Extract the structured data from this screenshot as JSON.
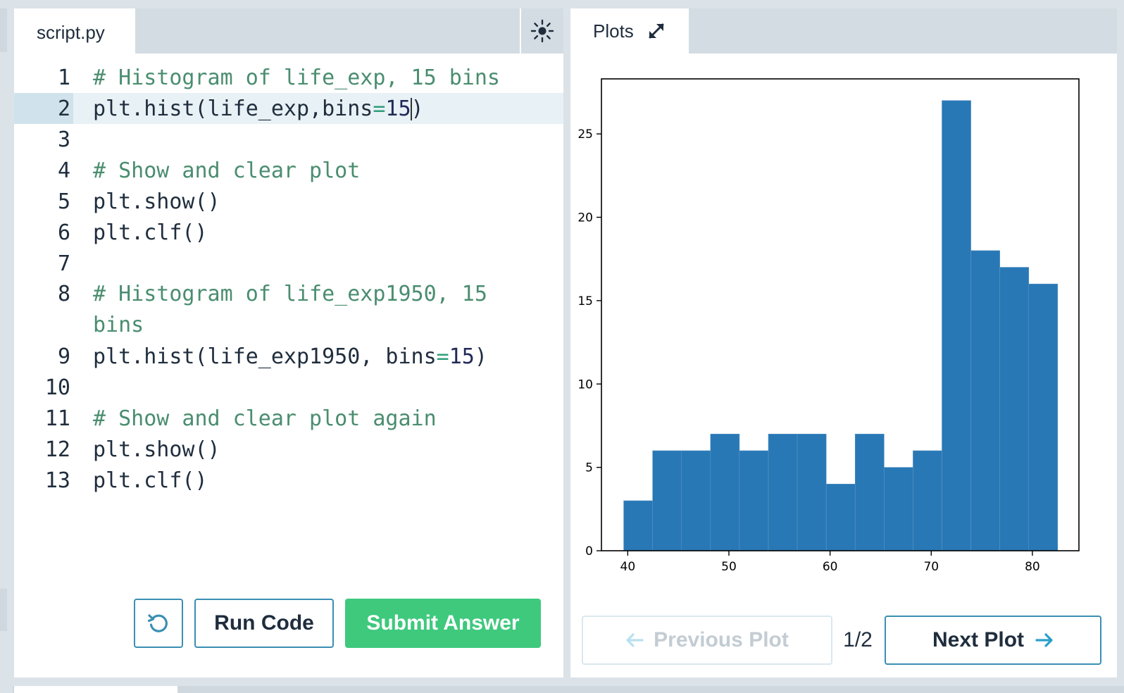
{
  "editor": {
    "tab_label": "script.py",
    "theme_icon": "sun-icon",
    "lines": [
      {
        "n": "1",
        "segments": [
          {
            "t": "# Histogram of life_exp, 15 bins",
            "c": "cm"
          }
        ]
      },
      {
        "n": "2",
        "active": true,
        "segments": [
          {
            "t": "plt.hist(life_exp,bins",
            "c": ""
          },
          {
            "t": "=",
            "c": "op"
          },
          {
            "t": "15",
            "c": "num"
          },
          {
            "t": "|",
            "c": "cursor"
          },
          {
            "t": ")",
            "c": ""
          }
        ]
      },
      {
        "n": "3",
        "segments": []
      },
      {
        "n": "4",
        "segments": [
          {
            "t": "# Show and clear plot",
            "c": "cm"
          }
        ]
      },
      {
        "n": "5",
        "segments": [
          {
            "t": "plt.show()",
            "c": ""
          }
        ]
      },
      {
        "n": "6",
        "segments": [
          {
            "t": "plt.clf()",
            "c": ""
          }
        ]
      },
      {
        "n": "7",
        "segments": []
      },
      {
        "n": "8",
        "tall": true,
        "segments": [
          {
            "t": "# Histogram of life_exp1950, 15 bins",
            "c": "cm"
          }
        ]
      },
      {
        "n": "9",
        "segments": [
          {
            "t": "plt.hist(life_exp1950, bins",
            "c": ""
          },
          {
            "t": "=",
            "c": "op"
          },
          {
            "t": "15",
            "c": "num"
          },
          {
            "t": ")",
            "c": ""
          }
        ]
      },
      {
        "n": "10",
        "segments": []
      },
      {
        "n": "11",
        "segments": [
          {
            "t": "# Show and clear plot again",
            "c": "cm"
          }
        ]
      },
      {
        "n": "12",
        "segments": [
          {
            "t": "plt.show()",
            "c": ""
          }
        ]
      },
      {
        "n": "13",
        "segments": [
          {
            "t": "plt.clf()",
            "c": ""
          }
        ]
      }
    ],
    "run_label": "Run Code",
    "submit_label": "Submit Answer",
    "reset_icon": "undo-icon"
  },
  "plots": {
    "tab_label": "Plots",
    "expand_icon": "expand-icon",
    "prev_label": "Previous Plot",
    "next_label": "Next Plot",
    "page_indicator": "1/2"
  },
  "colors": {
    "accent": "#3a8fb3",
    "submit": "#3ec97d",
    "bar": "#2878b5"
  },
  "chart_data": {
    "type": "bar",
    "title": "",
    "xlabel": "",
    "ylabel": "",
    "bin_edges": [
      39.6,
      42.46,
      45.32,
      48.18,
      51.04,
      53.9,
      56.76,
      59.62,
      62.48,
      65.34,
      68.2,
      71.06,
      73.92,
      76.78,
      79.64,
      82.5
    ],
    "counts": [
      3,
      6,
      6,
      7,
      6,
      7,
      7,
      4,
      7,
      5,
      6,
      27,
      18,
      17,
      16
    ],
    "xlim": [
      37.4,
      84.6
    ],
    "ylim": [
      0,
      28.3
    ],
    "xticks": [
      40,
      50,
      60,
      70,
      80
    ],
    "yticks": [
      0,
      5,
      10,
      15,
      20,
      25
    ],
    "grid": false
  }
}
